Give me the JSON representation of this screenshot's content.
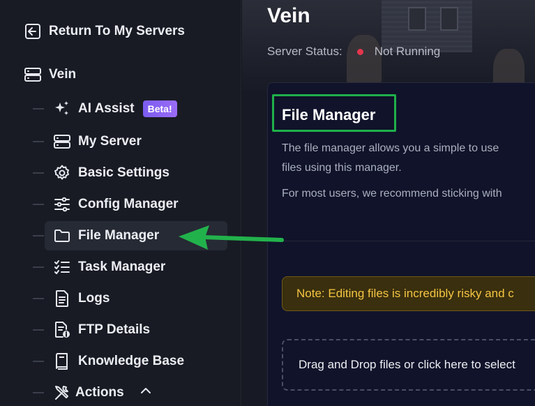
{
  "sidebar": {
    "return_label": "Return To My Servers",
    "server_name": "Vein",
    "items": [
      {
        "label": "AI Assist",
        "icon": "sparkles-icon",
        "badge": "Beta!"
      },
      {
        "label": "My Server",
        "icon": "server-icon"
      },
      {
        "label": "Basic Settings",
        "icon": "gear-icon"
      },
      {
        "label": "Config Manager",
        "icon": "sliders-icon"
      },
      {
        "label": "File Manager",
        "icon": "folder-icon",
        "active": true
      },
      {
        "label": "Task Manager",
        "icon": "checklist-icon"
      },
      {
        "label": "Logs",
        "icon": "document-icon"
      },
      {
        "label": "FTP Details",
        "icon": "file-info-icon"
      },
      {
        "label": "Knowledge Base",
        "icon": "book-icon"
      },
      {
        "label": "Actions",
        "icon": "tools-icon"
      }
    ]
  },
  "header": {
    "title": "Vein",
    "status_label": "Server Status:",
    "status_value": "Not Running",
    "status_color": "#e3364c"
  },
  "file_manager": {
    "title": "File Manager",
    "description_line1": "The file manager allows you a simple to use",
    "description_line2": "files using this manager.",
    "description_line3": "For most users, we recommend sticking with",
    "note": "Note: Editing files is incredibly risky and c",
    "dropzone": "Drag and Drop files or click here to select"
  },
  "colors": {
    "accent_green": "#1fb04a",
    "badge_purple": "#8a62f3",
    "note_text": "#f5c542"
  }
}
